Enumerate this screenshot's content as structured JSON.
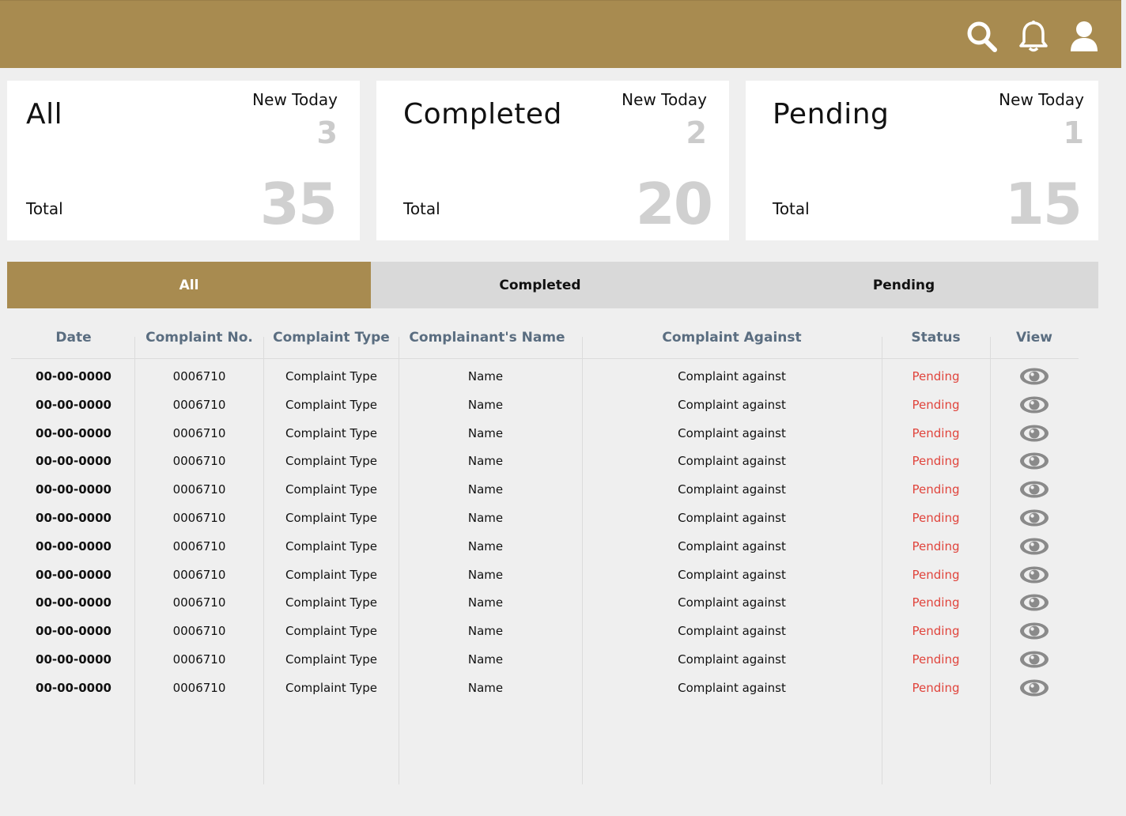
{
  "header": {
    "icons": [
      "search-icon",
      "bell-icon",
      "user-icon"
    ]
  },
  "cards": [
    {
      "title": "All",
      "new_today_label": "New Today",
      "new_today": "3",
      "total_label": "Total",
      "total": "35"
    },
    {
      "title": "Completed",
      "new_today_label": "New Today",
      "new_today": "2",
      "total_label": "Total",
      "total": "20"
    },
    {
      "title": "Pending",
      "new_today_label": "New Today",
      "new_today": "1",
      "total_label": "Total",
      "total": "15"
    }
  ],
  "tabs": [
    {
      "label": "All",
      "active": true
    },
    {
      "label": "Completed",
      "active": false
    },
    {
      "label": "Pending",
      "active": false
    }
  ],
  "table": {
    "columns": [
      "Date",
      "Complaint  No.",
      "Complaint Type",
      "Complainant's Name",
      "Complaint Against",
      "Status",
      "View"
    ],
    "rows": [
      {
        "date": "00-00-0000",
        "no": "0006710",
        "type": "Complaint Type",
        "name": "Name",
        "against": "Complaint against",
        "status": "Pending",
        "view_icon": "eye-icon"
      },
      {
        "date": "00-00-0000",
        "no": "0006710",
        "type": "Complaint Type",
        "name": "Name",
        "against": "Complaint against",
        "status": "Pending",
        "view_icon": "eye-icon"
      },
      {
        "date": "00-00-0000",
        "no": "0006710",
        "type": "Complaint Type",
        "name": "Name",
        "against": "Complaint against",
        "status": "Pending",
        "view_icon": "eye-icon"
      },
      {
        "date": "00-00-0000",
        "no": "0006710",
        "type": "Complaint Type",
        "name": "Name",
        "against": "Complaint against",
        "status": "Pending",
        "view_icon": "eye-icon"
      },
      {
        "date": "00-00-0000",
        "no": "0006710",
        "type": "Complaint Type",
        "name": "Name",
        "against": "Complaint against",
        "status": "Pending",
        "view_icon": "eye-icon"
      },
      {
        "date": "00-00-0000",
        "no": "0006710",
        "type": "Complaint Type",
        "name": "Name",
        "against": "Complaint against",
        "status": "Pending",
        "view_icon": "eye-icon"
      },
      {
        "date": "00-00-0000",
        "no": "0006710",
        "type": "Complaint Type",
        "name": "Name",
        "against": "Complaint against",
        "status": "Pending",
        "view_icon": "eye-icon"
      },
      {
        "date": "00-00-0000",
        "no": "0006710",
        "type": "Complaint Type",
        "name": "Name",
        "against": "Complaint against",
        "status": "Pending",
        "view_icon": "eye-icon"
      },
      {
        "date": "00-00-0000",
        "no": "0006710",
        "type": "Complaint Type",
        "name": "Name",
        "against": "Complaint against",
        "status": "Pending",
        "view_icon": "eye-icon"
      },
      {
        "date": "00-00-0000",
        "no": "0006710",
        "type": "Complaint Type",
        "name": "Name",
        "against": "Complaint against",
        "status": "Pending",
        "view_icon": "eye-icon"
      },
      {
        "date": "00-00-0000",
        "no": "0006710",
        "type": "Complaint Type",
        "name": "Name",
        "against": "Complaint against",
        "status": "Pending",
        "view_icon": "eye-icon"
      },
      {
        "date": "00-00-0000",
        "no": "0006710",
        "type": "Complaint Type",
        "name": "Name",
        "against": "Complaint against",
        "status": "Pending",
        "view_icon": "eye-icon"
      }
    ]
  },
  "colors": {
    "brand": "#a88b50",
    "tab_inactive": "#d9d9d9",
    "status_pending": "#e0443c",
    "header_text": "#5a6d80",
    "muted_number": "#d0d0d0"
  }
}
